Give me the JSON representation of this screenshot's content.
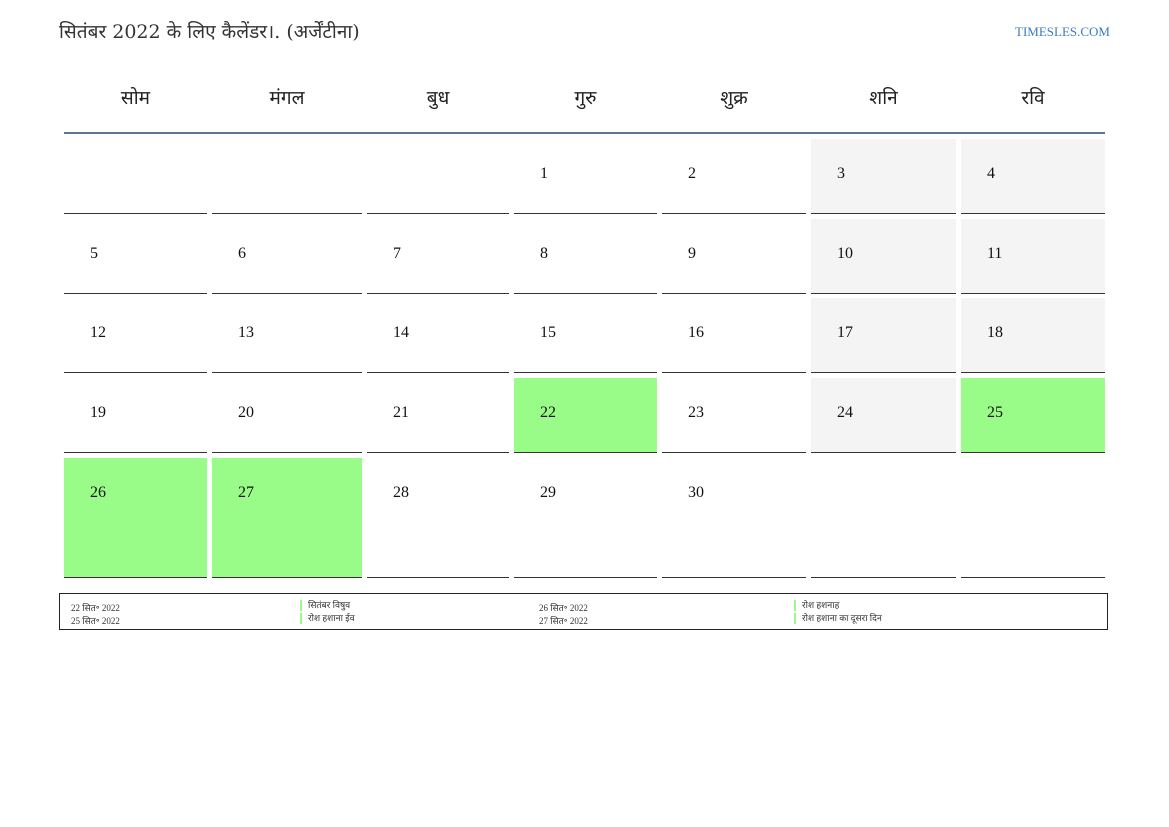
{
  "header": {
    "title": "सितंबर 2022 के लिए कैलेंडर।. (अर्जेंटीना)",
    "site": "TIMESLES.COM"
  },
  "weekdays": [
    "सोम",
    "मंगल",
    "बुध",
    "गुरु",
    "शुक्र",
    "शनि",
    "रवि"
  ],
  "colors": {
    "holiday": "#99fc88",
    "weekend": "#f4f4f4",
    "header_rule": "#5a7595",
    "link": "#3b7bbf"
  },
  "weeks": [
    [
      {
        "day": "",
        "type": "normal"
      },
      {
        "day": "",
        "type": "normal"
      },
      {
        "day": "",
        "type": "normal"
      },
      {
        "day": "1",
        "type": "normal"
      },
      {
        "day": "2",
        "type": "normal"
      },
      {
        "day": "3",
        "type": "weekend"
      },
      {
        "day": "4",
        "type": "weekend"
      }
    ],
    [
      {
        "day": "5",
        "type": "normal"
      },
      {
        "day": "6",
        "type": "normal"
      },
      {
        "day": "7",
        "type": "normal"
      },
      {
        "day": "8",
        "type": "normal"
      },
      {
        "day": "9",
        "type": "normal"
      },
      {
        "day": "10",
        "type": "weekend"
      },
      {
        "day": "11",
        "type": "weekend"
      }
    ],
    [
      {
        "day": "12",
        "type": "normal"
      },
      {
        "day": "13",
        "type": "normal"
      },
      {
        "day": "14",
        "type": "normal"
      },
      {
        "day": "15",
        "type": "normal"
      },
      {
        "day": "16",
        "type": "normal"
      },
      {
        "day": "17",
        "type": "weekend"
      },
      {
        "day": "18",
        "type": "weekend"
      }
    ],
    [
      {
        "day": "19",
        "type": "normal"
      },
      {
        "day": "20",
        "type": "normal"
      },
      {
        "day": "21",
        "type": "normal"
      },
      {
        "day": "22",
        "type": "holiday"
      },
      {
        "day": "23",
        "type": "normal"
      },
      {
        "day": "24",
        "type": "weekend"
      },
      {
        "day": "25",
        "type": "holiday"
      }
    ],
    [
      {
        "day": "26",
        "type": "holiday"
      },
      {
        "day": "27",
        "type": "holiday"
      },
      {
        "day": "28",
        "type": "normal"
      },
      {
        "day": "29",
        "type": "normal"
      },
      {
        "day": "30",
        "type": "normal"
      },
      {
        "day": "",
        "type": "normal"
      },
      {
        "day": "",
        "type": "normal"
      }
    ]
  ],
  "legend": [
    {
      "date": "22 सित॰ 2022",
      "name": "सितंबर विषुव"
    },
    {
      "date": "26 सित॰ 2022",
      "name": "रोश हशनाह"
    },
    {
      "date": "25 सित॰ 2022",
      "name": "रोश हशाना ईव"
    },
    {
      "date": "27 सित॰ 2022",
      "name": "रोश हशाना का दूसरा दिन"
    }
  ]
}
